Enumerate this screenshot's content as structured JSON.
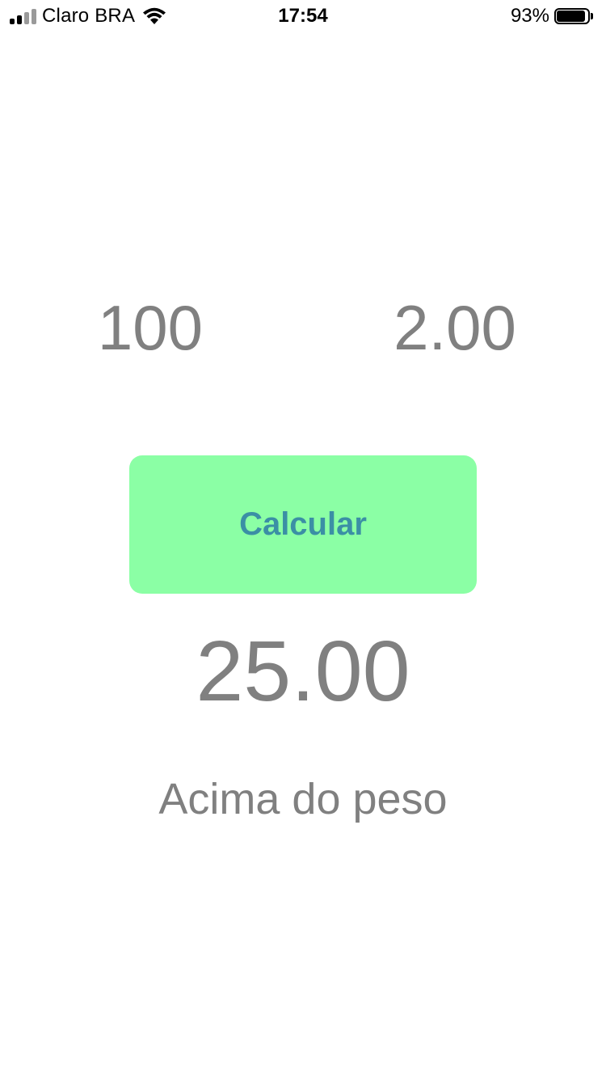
{
  "status_bar": {
    "carrier": "Claro BRA",
    "time": "17:54",
    "battery_percent_text": "93%",
    "battery_level": 0.93,
    "signal_icon": "cellular-signal-icon",
    "wifi_icon": "wifi-icon",
    "battery_icon": "battery-icon"
  },
  "form": {
    "weight_value": "100",
    "height_value": "2.00"
  },
  "button": {
    "label": "Calcular",
    "background_color": "#8bffa5",
    "text_color": "#3b8fa5"
  },
  "result": {
    "value": "25.00",
    "label": "Acima do peso"
  }
}
